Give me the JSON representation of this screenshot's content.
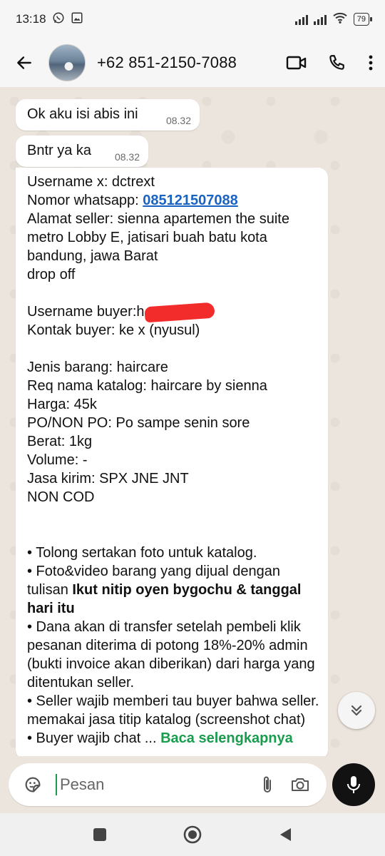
{
  "status": {
    "time": "13:18",
    "battery": "79"
  },
  "header": {
    "contact": "+62 851-2150-7088"
  },
  "messages": [
    {
      "text": "Ok aku isi abis ini",
      "time": "08.32"
    },
    {
      "text": "Bntr ya ka",
      "time": "08.32"
    }
  ],
  "form": {
    "username_x": "Username x: dctrext",
    "wa_label": "Nomor whatsapp: ",
    "wa_number": "085121507088",
    "alamat": "Alamat seller: sienna apartemen the suite metro Lobby E, jatisari buah batu kota bandung, jawa Barat",
    "drop": "drop off",
    "buyer_label": "Username buyer:h",
    "kontak": "Kontak buyer: ke x (nyusul)",
    "jenis": "Jenis barang: haircare",
    "req": "Req nama katalog: haircare by sienna",
    "harga": "Harga: 45k",
    "po": "PO/NON PO: Po sampe senin sore",
    "berat": "Berat: 1kg",
    "volume": "Volume: -",
    "jasa": "Jasa kirim: SPX JNE JNT",
    "noncod": "NON COD",
    "bullet1": "• Tolong sertakan foto untuk katalog.",
    "bullet2_pre": "• Foto&video barang yang dijual dengan tulisan ",
    "bullet2_bold": "Ikut nitip oyen bygochu & tanggal hari itu",
    "bullet3": "• Dana akan di transfer setelah pembeli klik pesanan diterima di potong 18%-20% admin (bukti invoice akan diberikan) dari harga yang ditentukan seller.",
    "bullet4": "• Seller wajib memberi tau buyer bahwa seller. memakai jasa titip katalog (screenshot chat)",
    "bullet5_pre": "• Buyer wajib chat ... ",
    "bullet5_link": "Baca selengkapnya"
  },
  "composer": {
    "placeholder": "Pesan"
  }
}
